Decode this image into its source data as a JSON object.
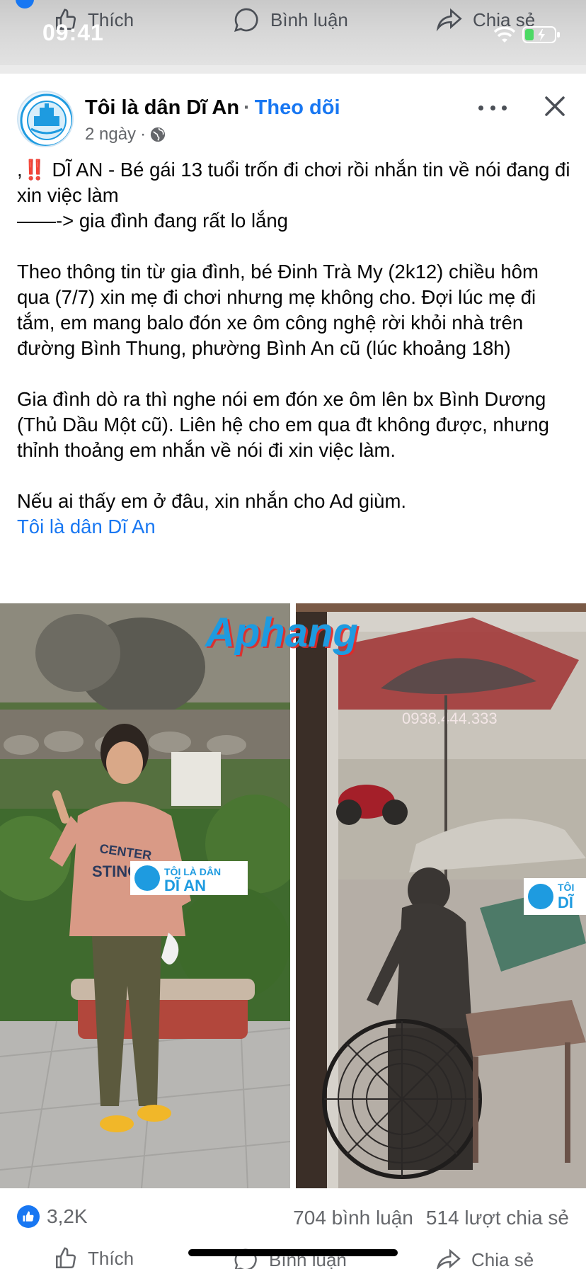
{
  "status_bar": {
    "time": "09:41"
  },
  "prev_post_actions": {
    "like": "Thích",
    "comment": "Bình luận",
    "share": "Chia sẻ"
  },
  "post": {
    "page_name": "Tôi là dân Dĩ An",
    "separator": "·",
    "follow": "Theo dõi",
    "time": "2 ngày",
    "time_separator": "·",
    "text": {
      "line1_prefix": ",",
      "line1_emoji": "‼️",
      "line1_rest": " DĨ AN - Bé gái 13 tuổi trốn đi chơi rồi nhắn tin về nói đang đi xin việc làm",
      "line2": "——-> gia đình đang rất lo lắng",
      "para2": "Theo thông tin từ gia đình, bé Đinh Trà My (2k12) chiều hôm qua (7/7) xin mẹ đi chơi nhưng mẹ không cho. Đợi lúc mẹ đi tắm, em mang balo đón xe ôm công nghệ rời khỏi nhà trên đường Bình Thung, phường Bình An cũ (lúc khoảng 18h)",
      "para3": "Gia đình dò ra thì nghe nói em đón xe ôm lên bx Bình Dương (Thủ Dầu Một cũ). Liên hệ cho em qua đt không được, nhưng thỉnh thoảng em nhắn về nói đi xin việc làm.",
      "para4": "Nếu ai thấy em ở đâu, xin nhắn cho Ad giùm.",
      "page_link": "Tôi là dân Dĩ An"
    },
    "photos": {
      "watermark": "Aphang",
      "left_sweater_text": "CENTER STINGERS",
      "badge_line1": "TÔI LÀ DÂN",
      "badge_line2": "DĨ AN",
      "right_umbrella_phone": "0938.444.333",
      "right_badge_line1": "TÔI",
      "right_badge_line2": "DĨ"
    },
    "stats": {
      "likes": "3,2K",
      "comments": "704 bình luận",
      "shares": "514 lượt chia sẻ"
    }
  },
  "post_actions": {
    "like": "Thích",
    "comment": "Bình luận",
    "share": "Chia sẻ"
  },
  "colors": {
    "brand_blue": "#1877f2",
    "text": "#050505",
    "muted": "#65676b",
    "alert_red": "#e4202a"
  },
  "icons": [
    "like-icon",
    "comment-icon",
    "share-icon",
    "globe-icon",
    "more-icon",
    "close-icon",
    "wifi-icon",
    "battery-icon"
  ]
}
